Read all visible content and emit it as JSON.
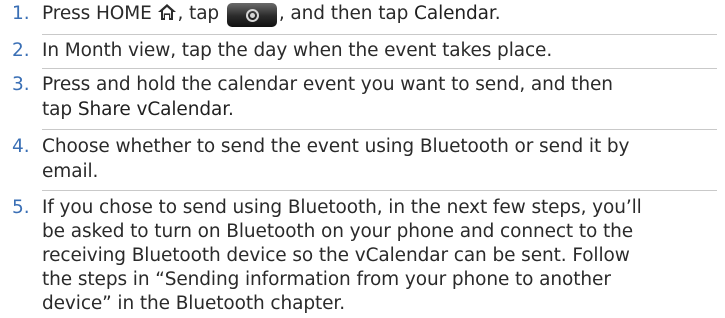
{
  "steps": [
    {
      "number": "1.",
      "parts": [
        "Press HOME ",
        ", tap ",
        ", and then tap ",
        "Calendar",
        "."
      ]
    },
    {
      "number": "2.",
      "lines": [
        "In Month view, tap the day when the event takes place."
      ]
    },
    {
      "number": "3.",
      "lines": [
        "Press and hold the calendar event you want to send, and then"
      ],
      "line2_prefix": "tap ",
      "line2_highlight": "Share vCalendar",
      "line2_suffix": "."
    },
    {
      "number": "4.",
      "lines": [
        "Choose whether to send the event using Bluetooth or send it by",
        "email."
      ]
    },
    {
      "number": "5.",
      "lines": [
        "If you chose to send using Bluetooth, in the next few steps, you’ll",
        "be asked to turn on Bluetooth on your phone and connect to the",
        "receiving Bluetooth device so the vCalendar can be sent. Follow",
        "the steps in “Sending information from your phone to another",
        "device” in the Bluetooth chapter."
      ]
    }
  ],
  "icons": {
    "home": "home-icon",
    "launch": "launch-button-icon"
  },
  "colors": {
    "step_number": "#3a6fb5",
    "text": "#2a2a2a",
    "separator": "#c9c9c9"
  }
}
